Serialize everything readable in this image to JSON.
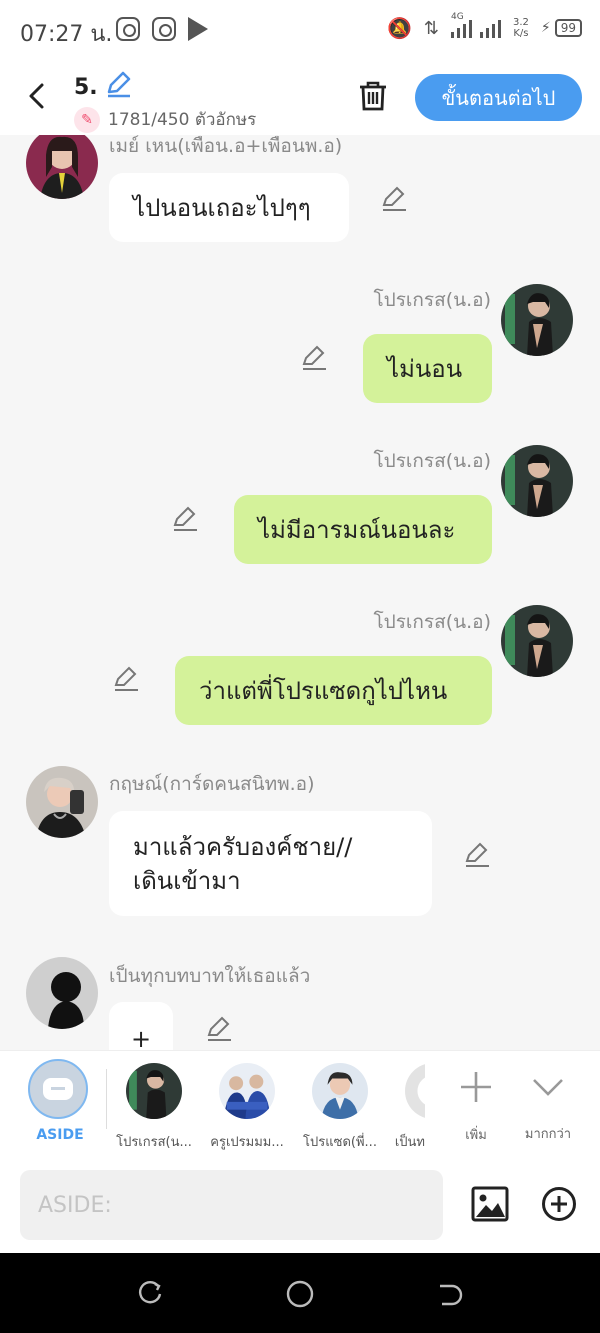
{
  "status_bar": {
    "time": "07:27 น.",
    "speed_value": "3.2",
    "speed_unit": "K/s",
    "network": "4G",
    "battery": "99",
    "icons": [
      "instagram-icon",
      "instagram-icon",
      "play-store-icon",
      "bell-off-icon",
      "data-arrows-icon",
      "signal-icon",
      "charging-icon",
      "battery-icon"
    ]
  },
  "header": {
    "title": "5.",
    "char_count": "1781/450 ตัวอักษร",
    "next_button": "ขั้นตอนต่อไป"
  },
  "messages": [
    {
      "side": "left",
      "name": "เมย์ เหน(เพื่อน.อ+เพื่อนพ.อ)",
      "text": "ไปนอนเถอะไปๆๆ"
    },
    {
      "side": "right",
      "name": "โปรเกรส(น.อ)",
      "text": "ไม่นอน"
    },
    {
      "side": "right",
      "name": "โปรเกรส(น.อ)",
      "text": "ไม่มีอารมณ์นอนละ"
    },
    {
      "side": "right",
      "name": "โปรเกรส(น.อ)",
      "text": "ว่าแต่พี่โปรแซดกูไปไหน"
    },
    {
      "side": "left",
      "name": "กฤษณ์(การ์ดคนสนิทพ.อ)",
      "text_line1": "มาแล้วครับองค์ชาย//",
      "text_line2": "เดินเข้ามา"
    },
    {
      "side": "left",
      "name": "เป็นทุกบทบาทให้เธอแล้ว",
      "text": "+"
    }
  ],
  "characters": {
    "aside_label": "ASIDE",
    "items": [
      "โปรเกรส(น...",
      "ครูเปรมมม...",
      "โปรแซด(พี่...",
      "เป็นท"
    ],
    "add_label": "เพิ่ม",
    "more_label": "มากกว่า"
  },
  "input": {
    "placeholder": "ASIDE:"
  }
}
